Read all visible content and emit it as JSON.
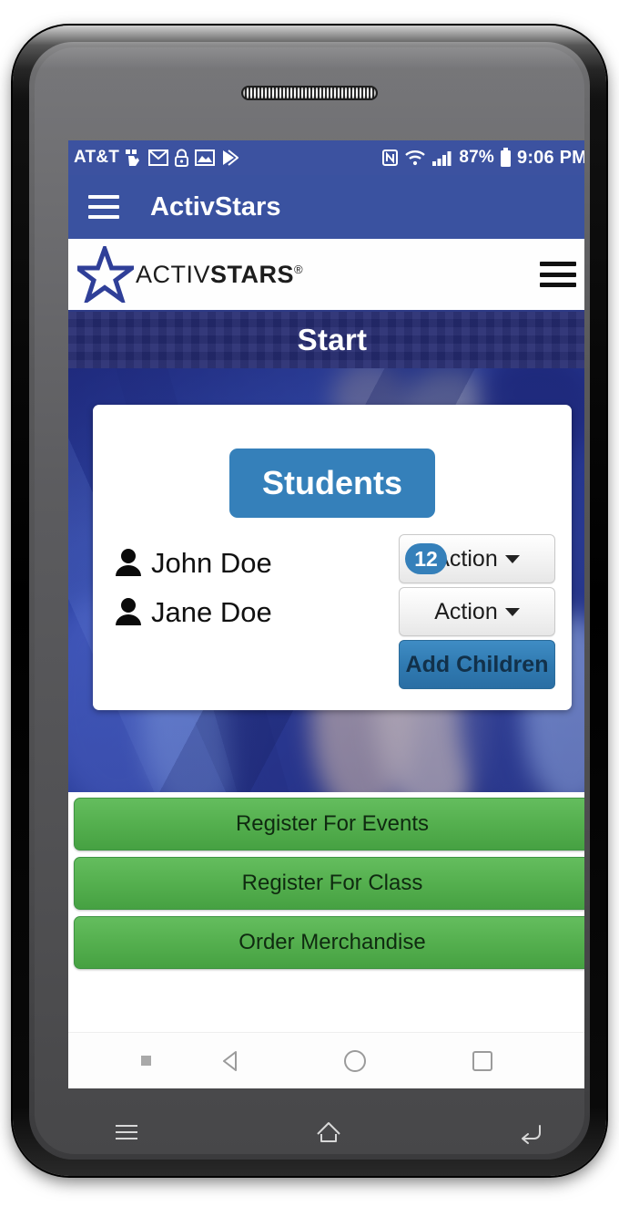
{
  "device": {
    "hardware_buttons": [
      {
        "name": "menu",
        "icon": "menu-icon"
      },
      {
        "name": "home",
        "icon": "home-icon"
      },
      {
        "name": "back",
        "icon": "back-icon"
      }
    ]
  },
  "status_bar": {
    "carrier": "AT&T",
    "left_icons": [
      "touch-icon",
      "gmail-icon",
      "lock-icon",
      "photos-icon",
      "play-store-icon"
    ],
    "right_icons": [
      "nfc-icon",
      "wifi-icon",
      "signal-icon"
    ],
    "battery_percent": "87%",
    "battery_icon": "battery-icon",
    "time": "9:06 PM",
    "background_color": "#3c52a0"
  },
  "app_bar": {
    "menu_icon": "hamburger-icon",
    "title": "ActivStars",
    "background_color": "#3a52a0"
  },
  "logo_bar": {
    "logo_activ": "ACTIV",
    "logo_stars": "STARS",
    "logo_registered": "®",
    "menu_icon": "hamburger-icon",
    "star_color": "#2f3f98"
  },
  "page_banner": {
    "title": "Start",
    "background_color": "#252b70"
  },
  "card": {
    "students_button": "Students",
    "students_button_color": "#3580ba",
    "rows": [
      {
        "name": "John Doe",
        "icon": "person-icon",
        "action_label": "Action",
        "badge": "12",
        "badge_color": "#3580ba",
        "has_badge": true
      },
      {
        "name": "Jane Doe",
        "icon": "person-icon",
        "action_label": "Action",
        "badge": "",
        "has_badge": false
      }
    ],
    "add_children_button": "Add Children",
    "add_children_color": "#2f79b0"
  },
  "green_buttons": [
    {
      "label": "Register For Events"
    },
    {
      "label": "Register For Class"
    },
    {
      "label": "Order Merchandise"
    }
  ],
  "green_color": "#55b04f",
  "nav_bar": {
    "buttons": [
      {
        "name": "dot",
        "icon": "dot-icon"
      },
      {
        "name": "back",
        "icon": "triangle-back-icon"
      },
      {
        "name": "home",
        "icon": "circle-home-icon"
      },
      {
        "name": "recent",
        "icon": "square-recent-icon"
      }
    ]
  }
}
